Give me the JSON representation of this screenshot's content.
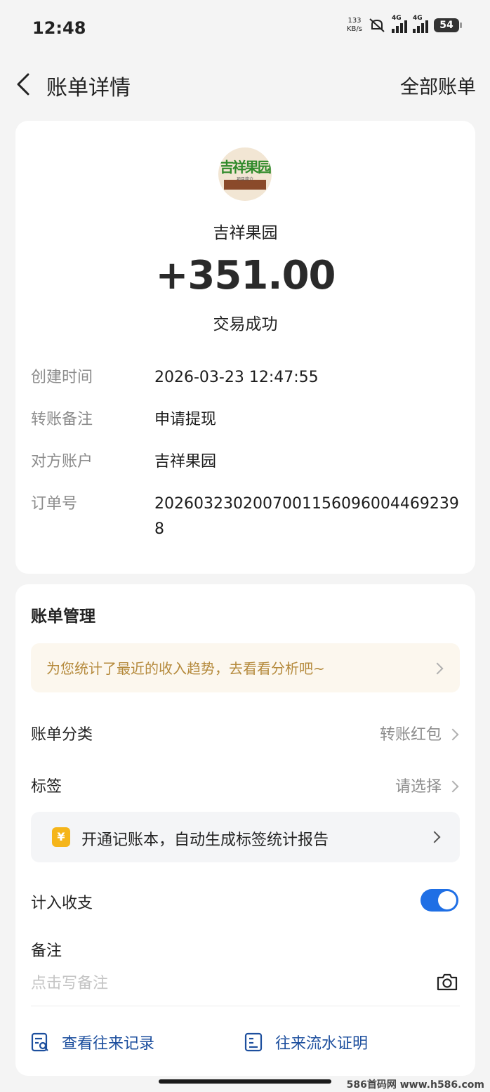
{
  "status": {
    "time": "12:48",
    "net_speed": "133",
    "net_unit": "KB/s",
    "sig1": "4G",
    "sig2": "4G",
    "battery": "54"
  },
  "nav": {
    "title": "账单详情",
    "right": "全部账单"
  },
  "merchant": {
    "logo_text": "吉祥果园",
    "logo_sub": "项目简介",
    "name": "吉祥果园",
    "amount": "+351.00",
    "status": "交易成功"
  },
  "details": [
    {
      "label": "创建时间",
      "value": "2026-03-23 12:47:55"
    },
    {
      "label": "转账备注",
      "value": "申请提现"
    },
    {
      "label": "对方账户",
      "value": "吉祥果园"
    },
    {
      "label": "订单号",
      "value": "20260323020070011560960044692398"
    }
  ],
  "manage": {
    "title": "账单管理",
    "promo": "为您统计了最近的收入趋势，去看看分析吧~",
    "category_label": "账单分类",
    "category_value": "转账红包",
    "tag_label": "标签",
    "tag_value": "请选择",
    "ledger_icon": "¥",
    "ledger_text": "开通记账本，自动生成标签统计报告",
    "include_label": "计入收支",
    "include_on": true,
    "remark_label": "备注",
    "remark_placeholder": "点击写备注",
    "link1": "查看往来记录",
    "link2": "往来流水证明"
  },
  "watermark": "586首码网 www.h586.com",
  "colors": {
    "accent": "#1f6fe5",
    "link": "#1d4f9e",
    "promo_text": "#b58a3c",
    "yen_badge": "#f5b51a"
  }
}
